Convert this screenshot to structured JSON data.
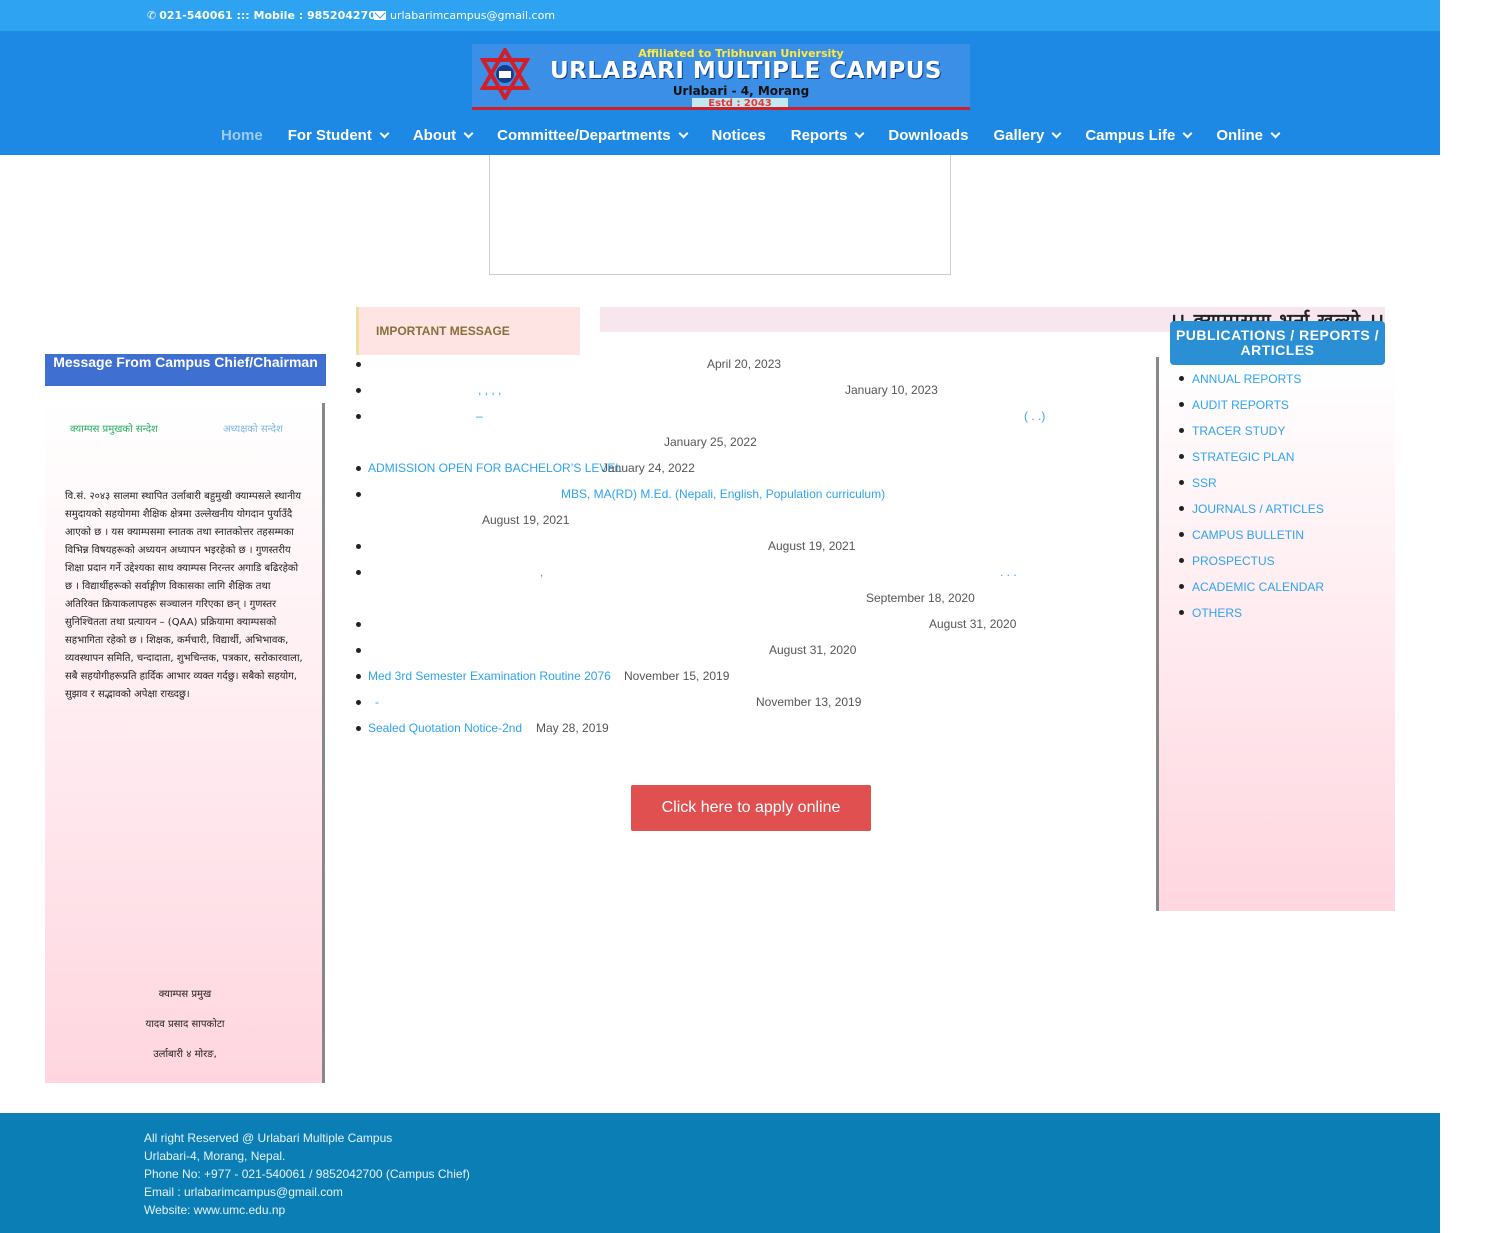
{
  "topbar": {
    "phone": "021-540061 ::: Mobile : 9852042700",
    "email": "urlabarimcampus@gmail.com"
  },
  "logo": {
    "affiliation": "Affiliated to Tribhuvan University",
    "name": "URLABARI MULTIPLE CAMPUS",
    "location": "Urlabari - 4, Morang",
    "estd": "Estd : 2043"
  },
  "nav": [
    {
      "label": "Home",
      "active": true,
      "dropdown": false
    },
    {
      "label": "For Student",
      "active": false,
      "dropdown": true
    },
    {
      "label": "About",
      "active": false,
      "dropdown": true
    },
    {
      "label": "Committee/Departments",
      "active": false,
      "dropdown": true
    },
    {
      "label": "Notices",
      "active": false,
      "dropdown": false
    },
    {
      "label": "Reports",
      "active": false,
      "dropdown": true
    },
    {
      "label": "Downloads",
      "active": false,
      "dropdown": false
    },
    {
      "label": "Gallery",
      "active": false,
      "dropdown": true
    },
    {
      "label": "Campus Life",
      "active": false,
      "dropdown": true
    },
    {
      "label": "Online",
      "active": false,
      "dropdown": true
    }
  ],
  "left": {
    "heading": "Message From Campus Chief/Chairman",
    "tab1": "क्याम्पस प्रमुखको सन्देश",
    "tab2": "अध्यक्षको सन्देश",
    "message": "वि.सं. २०४३ सालमा स्थापित उर्लाबारी बहुमुखी क्याम्पसले स्थानीय समुदायको सहयोगमा शैक्षिक क्षेत्रमा उल्लेखनीय योगदान पुर्याउँदै आएको छ । यस क्याम्पसमा स्नातक तथा स्नातकोत्तर तहसम्मका विभिन्न विषयहरूको अध्ययन अध्यापन भइरहेको छ । गुणस्तरीय शिक्षा प्रदान गर्ने उद्देश्यका साथ क्याम्पस निरन्तर अगाडि बढिरहेको छ । विद्यार्थीहरूको सर्वाङ्गीण विकासका लागि शैक्षिक तथा अतिरिक्त क्रियाकलापहरू सञ्चालन गरिएका छन् । गुणस्तर सुनिश्चितता तथा प्रत्यायन – (QAA) प्रक्रियामा क्याम्पसको सहभागिता रहेको छ । शिक्षक, कर्मचारी, विद्यार्थी, अभिभावक, व्यवस्थापन समिति, चन्दादाता, शुभचिन्तक, पत्रकार, सरोकारवाला, सबै सहयोगीहरूप्रति हार्दिक आभार व्यक्त गर्दछु। सबैको सहयोग, सुझाव र सद्भावको अपेक्षा राख्दछु।",
    "sig1": "क्याम्पस प्रमुख",
    "sig2": "यादव प्रसाद सापकोटा",
    "sig3": "उर्लाबारी ४ मोरङ,"
  },
  "important": {
    "label": "IMPORTANT MESSAGE",
    "marquee": "।। क्याम्पसमा भर्ना खुल्यो ।।"
  },
  "notices": [
    {
      "title": "",
      "date": "April 20, 2023"
    },
    {
      "title": "",
      "date": "January 10, 2023"
    },
    {
      "title": "",
      "date": "January 25, 2022"
    },
    {
      "title": "ADMISSION OPEN FOR BACHELOR’S LEVEL",
      "date": "January 24, 2022"
    },
    {
      "title": "MBS, MA(RD)    M.Ed. (Nepali, English, Population curriculum)",
      "date": "August 19, 2021"
    },
    {
      "title": "",
      "date": "August 19, 2021"
    },
    {
      "title": "",
      "date": "September 18, 2020"
    },
    {
      "title": "",
      "date": "August 31, 2020"
    },
    {
      "title": "",
      "date": "August 31, 2020"
    },
    {
      "title": "Med 3rd Semester Examination Routine 2076",
      "date": "November 15, 2019"
    },
    {
      "title": "-",
      "date": "November 13, 2019"
    },
    {
      "title": "Sealed Quotation Notice-2nd",
      "date": "May 28, 2019"
    }
  ],
  "notice_fragments": {
    "n2": ",  ,  ,  ,",
    "n3a": "–",
    "n3b": "(    .  .)",
    "n7a": ",",
    "n7b": ".  .  ."
  },
  "apply_button": "Click here to apply online",
  "publications": {
    "heading": "PUBLICATIONS / REPORTS / ARTICLES",
    "items": [
      "ANNUAL REPORTS",
      "AUDIT REPORTS",
      "TRACER STUDY",
      "STRATEGIC PLAN",
      "SSR",
      "JOURNALS / ARTICLES",
      "CAMPUS BULLETIN",
      "PROSPECTUS",
      "ACADEMIC CALENDAR",
      "OTHERS"
    ]
  },
  "footer": {
    "line1": "All right Reserved @ Urlabari Multiple Campus",
    "line2": "Urlabari-4, Morang, Nepal.",
    "line3": "Phone No: +977 - 021-540061 / 9852042700 (Campus Chief)",
    "line4": "Email : urlabarimcampus@gmail.com",
    "line5": "Website: www.umc.edu.np"
  },
  "colors": {
    "topbar": "#2ea3f2",
    "header": "#1e88e5",
    "link": "#2ea3f2",
    "apply": "#e05050",
    "footer": "#0a7eb5"
  }
}
